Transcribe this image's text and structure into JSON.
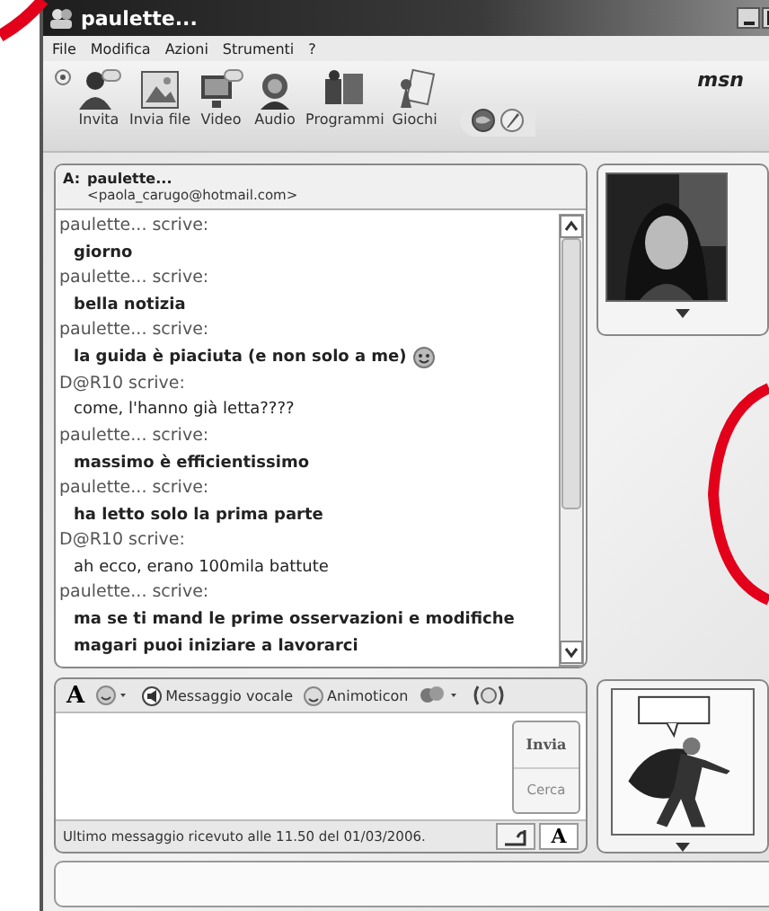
{
  "window": {
    "title": "paulette..."
  },
  "menu": [
    "File",
    "Modifica",
    "Azioni",
    "Strumenti",
    "?"
  ],
  "toolbar": [
    {
      "kind": "invite",
      "label": "Invita"
    },
    {
      "kind": "file",
      "label": "Invia file"
    },
    {
      "kind": "video",
      "label": "Video"
    },
    {
      "kind": "audio",
      "label": "Audio"
    },
    {
      "kind": "programs",
      "label": "Programmi"
    },
    {
      "kind": "games",
      "label": "Giochi"
    }
  ],
  "brand": "msn",
  "conversation": {
    "to_label": "A:",
    "to_name": "paulette...",
    "to_email": "<paola_carugo@hotmail.com>",
    "messages": [
      {
        "kind": "speaker",
        "text": "paulette... scrive:"
      },
      {
        "kind": "message",
        "text": "giorno"
      },
      {
        "kind": "speaker",
        "text": "paulette... scrive:"
      },
      {
        "kind": "message",
        "text": "bella notizia"
      },
      {
        "kind": "speaker",
        "text": "paulette... scrive:"
      },
      {
        "kind": "message",
        "text": "la guida è piaciuta (e non solo a me)",
        "emoticon": true
      },
      {
        "kind": "speaker",
        "text": "D@R10 scrive:"
      },
      {
        "kind": "plain",
        "text": "come, l'hanno già letta????"
      },
      {
        "kind": "speaker",
        "text": "paulette... scrive:"
      },
      {
        "kind": "message",
        "text": "massimo è efficientissimo"
      },
      {
        "kind": "speaker",
        "text": "paulette... scrive:"
      },
      {
        "kind": "message",
        "text": "ha letto solo la prima parte"
      },
      {
        "kind": "speaker",
        "text": "D@R10 scrive:"
      },
      {
        "kind": "plain",
        "text": "ah ecco, erano 100mila battute"
      },
      {
        "kind": "speaker",
        "text": "paulette... scrive:"
      },
      {
        "kind": "message",
        "text": "ma se ti mand le prime osservazioni e modifiche"
      },
      {
        "kind": "message",
        "text": "magari puoi iniziare a lavorarci"
      }
    ]
  },
  "compose": {
    "font_button": "A",
    "voice_clip": "Messaggio vocale",
    "animoticon": "Animoticon",
    "send": "Invia",
    "search": "Cerca",
    "status": "Ultimo messaggio ricevuto alle 11.50 del 01/03/2006.",
    "text_tab": "A"
  }
}
